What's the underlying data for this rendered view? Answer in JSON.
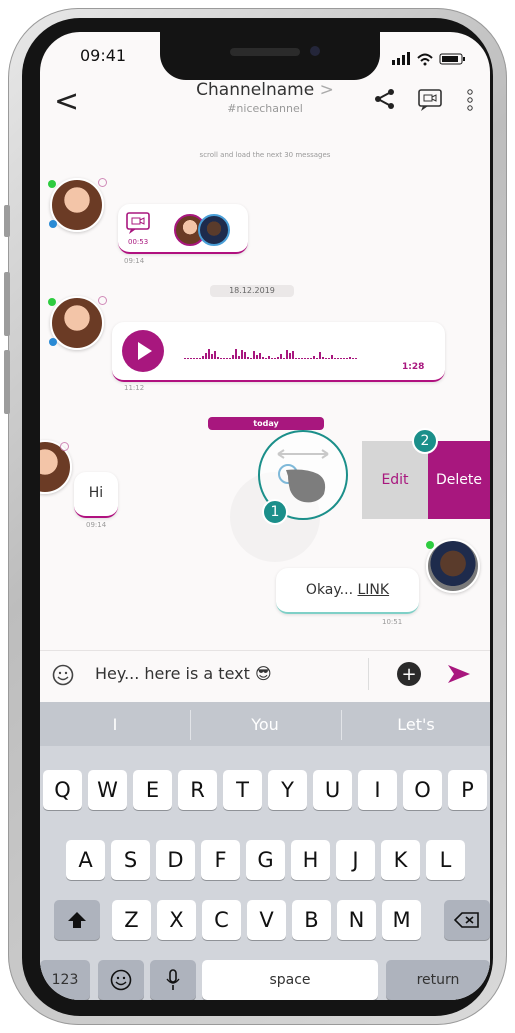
{
  "status": {
    "time": "09:41"
  },
  "header": {
    "channel_name": "Channelname",
    "chevron": ">",
    "channel_handle": "#nicechannel",
    "back_glyph": "<",
    "icons": [
      "share-icon",
      "video-call-icon",
      "more-vertical-icon"
    ]
  },
  "messages": {
    "load_more": "scroll and load the next 30 messages",
    "video_call": {
      "duration": "00:53",
      "time": "09:14"
    },
    "date_separator": "18.12.2019",
    "voice": {
      "duration": "1:28",
      "time": "11:12"
    },
    "today_separator": "today",
    "hi": {
      "text": "Hi",
      "time": "09:14"
    },
    "okay": {
      "text": "Okay... ",
      "link": "LINK",
      "time": "10:51"
    }
  },
  "swipe": {
    "edit_label": "Edit",
    "delete_label": "Delete",
    "step1": "1",
    "step2": "2"
  },
  "composer": {
    "text": "Hey... here is a text 😎",
    "plus": "+"
  },
  "keyboard": {
    "suggestions": [
      "I",
      "You",
      "Let's"
    ],
    "row1": [
      "Q",
      "W",
      "E",
      "R",
      "T",
      "Y",
      "U",
      "I",
      "O",
      "P"
    ],
    "row2": [
      "A",
      "S",
      "D",
      "F",
      "G",
      "H",
      "J",
      "K",
      "L"
    ],
    "row3": [
      "Z",
      "X",
      "C",
      "V",
      "B",
      "N",
      "M"
    ],
    "numbers": "123",
    "space": "space",
    "return": "return"
  },
  "colors": {
    "accent": "#a8177e",
    "teal": "#1b8f8a",
    "online": "#2ecc40"
  }
}
